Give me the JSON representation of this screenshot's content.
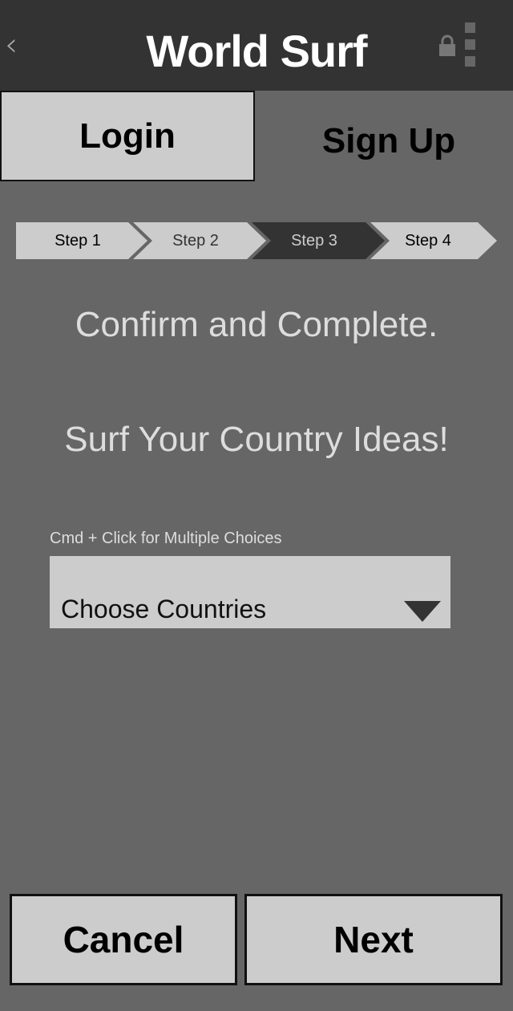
{
  "header": {
    "title": "World Surf",
    "back_icon": "chevron-left-icon",
    "lock_icon": "lock-icon",
    "menu_icon": "more-vertical-icon"
  },
  "tabs": [
    {
      "label": "Login",
      "active": true
    },
    {
      "label": "Sign Up",
      "active": false
    }
  ],
  "steps": [
    {
      "label": "Step 1",
      "state": "done"
    },
    {
      "label": "Step 2",
      "state": "upcoming"
    },
    {
      "label": "Step 3",
      "state": "current"
    },
    {
      "label": "Step 4",
      "state": "upcoming"
    }
  ],
  "main": {
    "heading": "Confirm and Complete.",
    "subheading": "Surf Your Country Ideas!",
    "select_hint": "Cmd + Click for Multiple Choices",
    "select_value": "Choose Countries",
    "dropdown_icon": "caret-down-icon"
  },
  "footer": {
    "cancel_label": "Cancel",
    "next_label": "Next"
  },
  "colors": {
    "background": "#666666",
    "topbar": "#333333",
    "panel": "#cccccc",
    "step_current": "#333333"
  }
}
